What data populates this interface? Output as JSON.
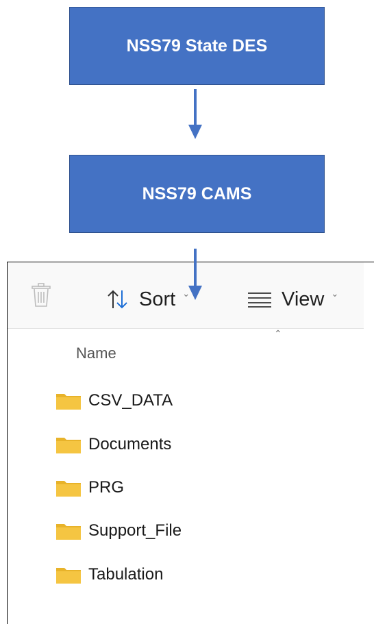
{
  "flow": {
    "step1": "NSS79 State DES",
    "step2": "NSS79 CAMS"
  },
  "explorer": {
    "toolbar": {
      "sort_label": "Sort",
      "view_label": "View"
    },
    "column_header": "Name",
    "items": [
      {
        "label": "CSV_DATA",
        "icon": "folder-icon"
      },
      {
        "label": "Documents",
        "icon": "folder-icon"
      },
      {
        "label": "PRG",
        "icon": "folder-icon"
      },
      {
        "label": "Support_File",
        "icon": "folder-icon"
      },
      {
        "label": "Tabulation",
        "icon": "folder-icon"
      }
    ]
  },
  "colors": {
    "box_fill": "#4472c4",
    "box_border": "#2f528f",
    "folder": "#f5c542"
  }
}
